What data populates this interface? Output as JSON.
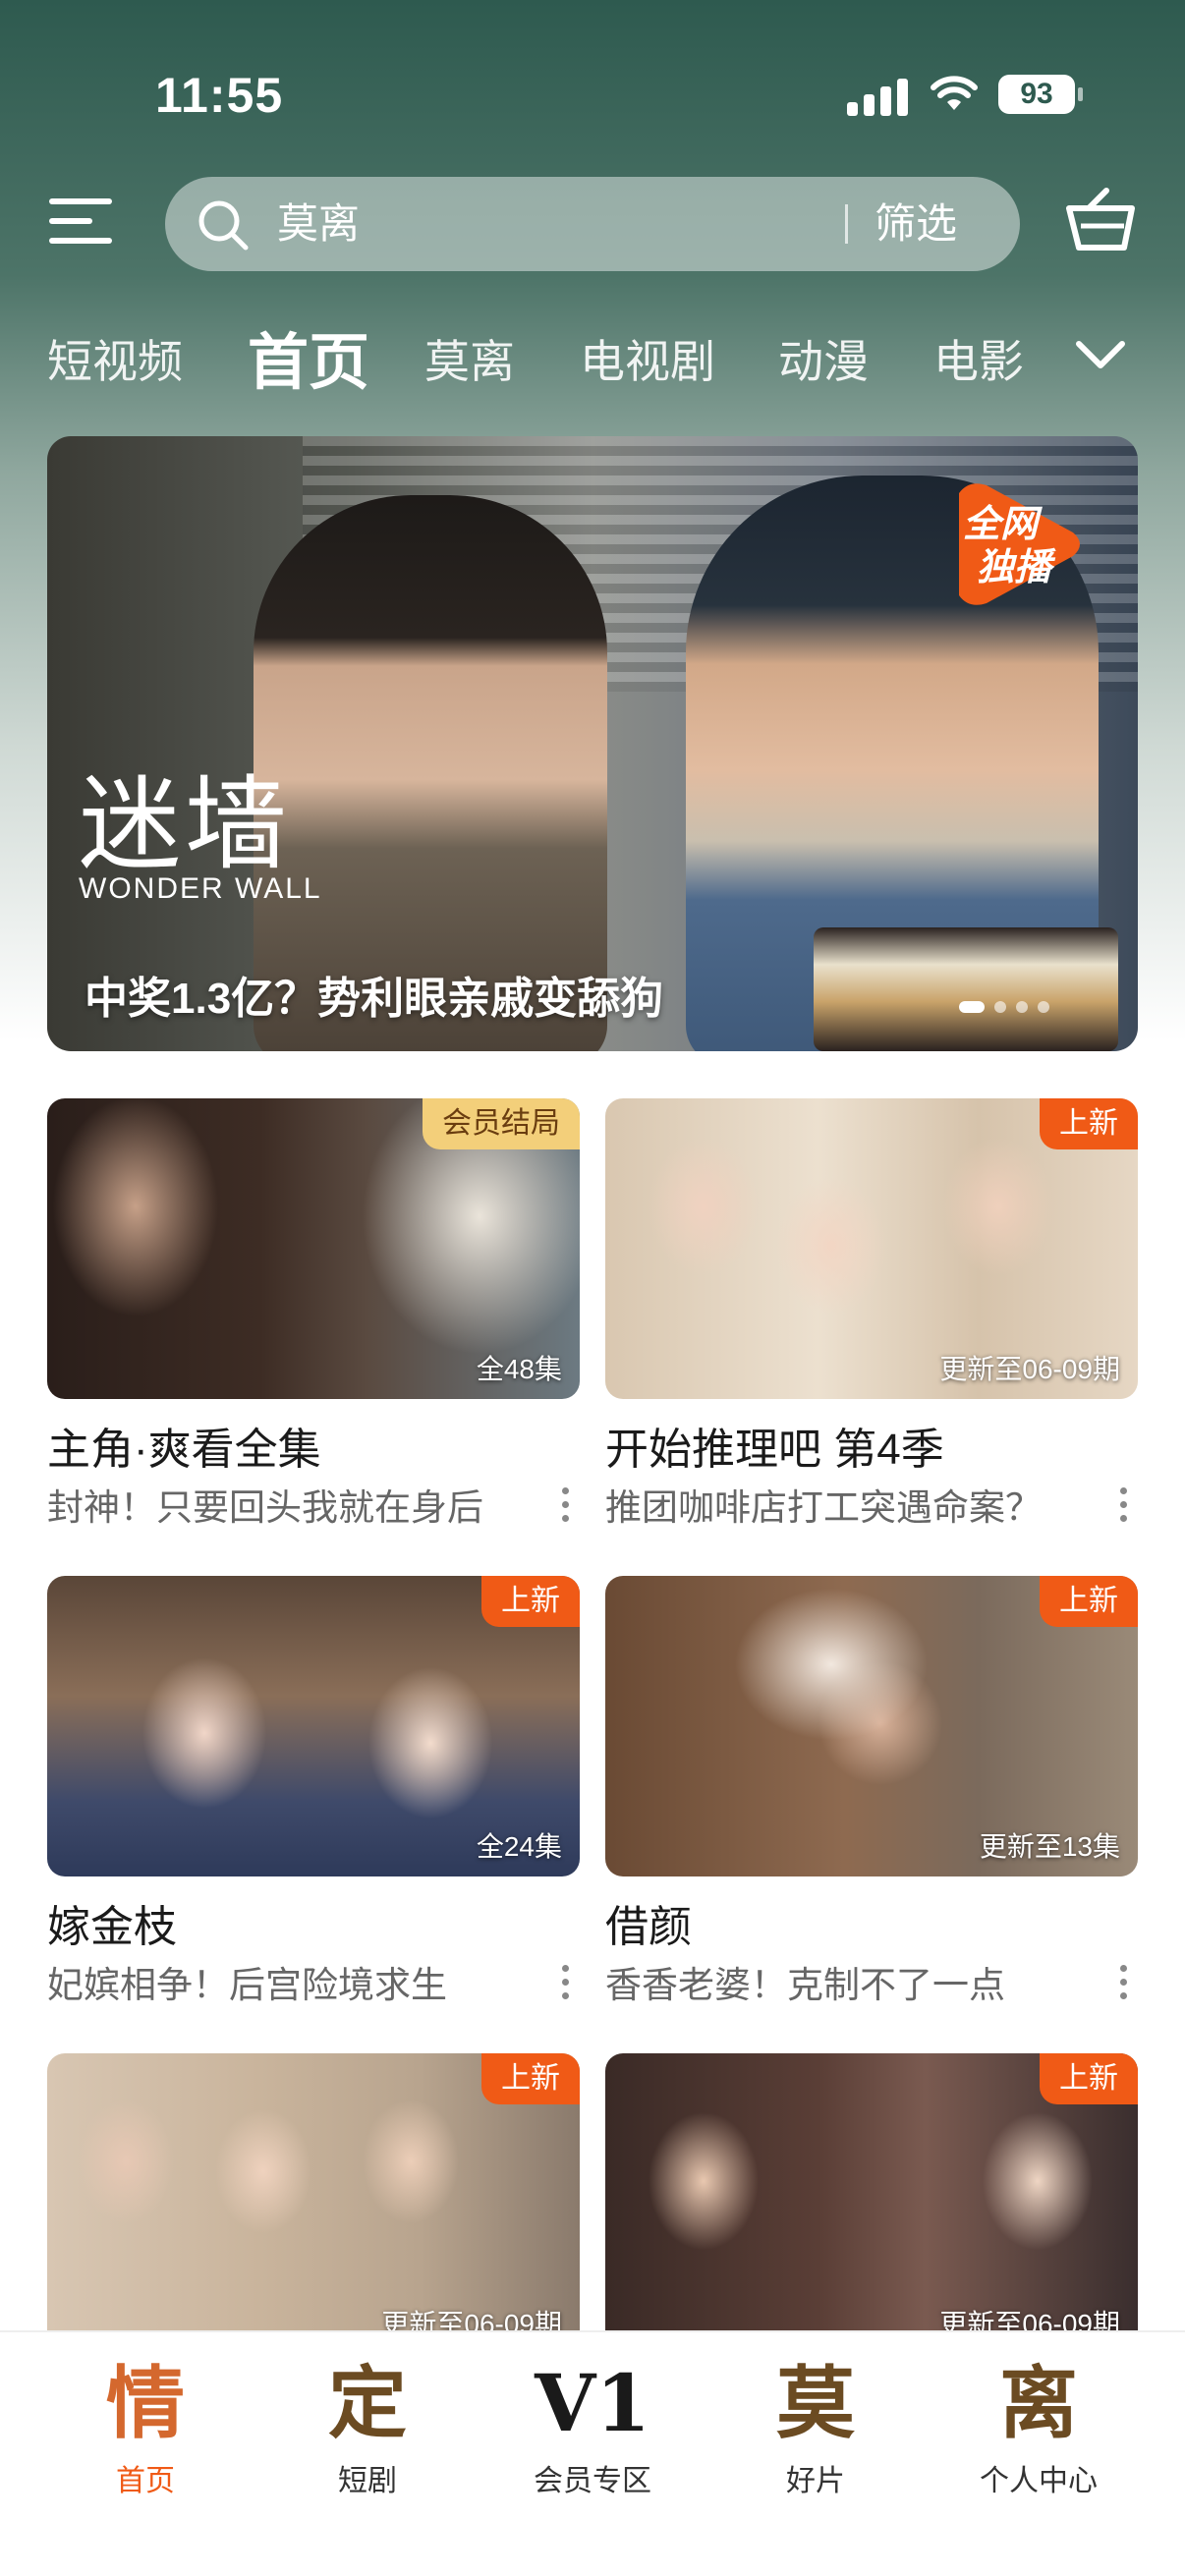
{
  "status_bar": {
    "time": "11:55",
    "battery": "93"
  },
  "header": {
    "search_text": "莫离",
    "filter_label": "筛选",
    "icons": [
      "menu-icon",
      "search-icon",
      "cart-icon"
    ]
  },
  "tabs": [
    {
      "label": "短视频",
      "active": false
    },
    {
      "label": "首页",
      "active": true
    },
    {
      "label": "莫离",
      "active": false
    },
    {
      "label": "电视剧",
      "active": false
    },
    {
      "label": "动漫",
      "active": false
    },
    {
      "label": "电影",
      "active": false
    }
  ],
  "banner": {
    "logo_cn": "迷墙",
    "logo_en": "WONDER WALL",
    "badge_line1": "全网",
    "badge_line2": "独播",
    "caption": "中奖1.3亿？势利眼亲戚变舔狗"
  },
  "cards": [
    {
      "title": "主角·爽看全集",
      "subtitle": "封神！只要回头我就在身后",
      "badge": "会员结局",
      "episodes": "全48集"
    },
    {
      "title": "开始推理吧 第4季",
      "subtitle": "推团咖啡店打工突遇命案？",
      "badge": "上新",
      "episodes": "更新至06-09期"
    },
    {
      "title": "嫁金枝",
      "subtitle": "妃嫔相争！后宫险境求生",
      "badge": "上新",
      "episodes": "全24集"
    },
    {
      "title": "借颜",
      "subtitle": "香香老婆！克制不了一点",
      "badge": "上新",
      "episodes": "更新至13集"
    },
    {
      "title": "",
      "subtitle": "",
      "badge": "上新",
      "episodes": "更新至06-09期"
    },
    {
      "title": "",
      "subtitle": "",
      "badge": "上新",
      "episodes": "更新至06-09期"
    }
  ],
  "bottom_nav": [
    {
      "glyph": "情",
      "label": "首页",
      "active": true
    },
    {
      "glyph": "定",
      "label": "短剧",
      "active": false
    },
    {
      "glyph": "V1",
      "label": "会员专区",
      "active": false
    },
    {
      "glyph": "莫",
      "label": "好片",
      "active": false
    },
    {
      "glyph": "离",
      "label": "个人中心",
      "active": false
    }
  ],
  "colors": {
    "accent": "#f05a16",
    "vip_badge": "#f3cf7a",
    "header_green": "#2e5a4f"
  }
}
